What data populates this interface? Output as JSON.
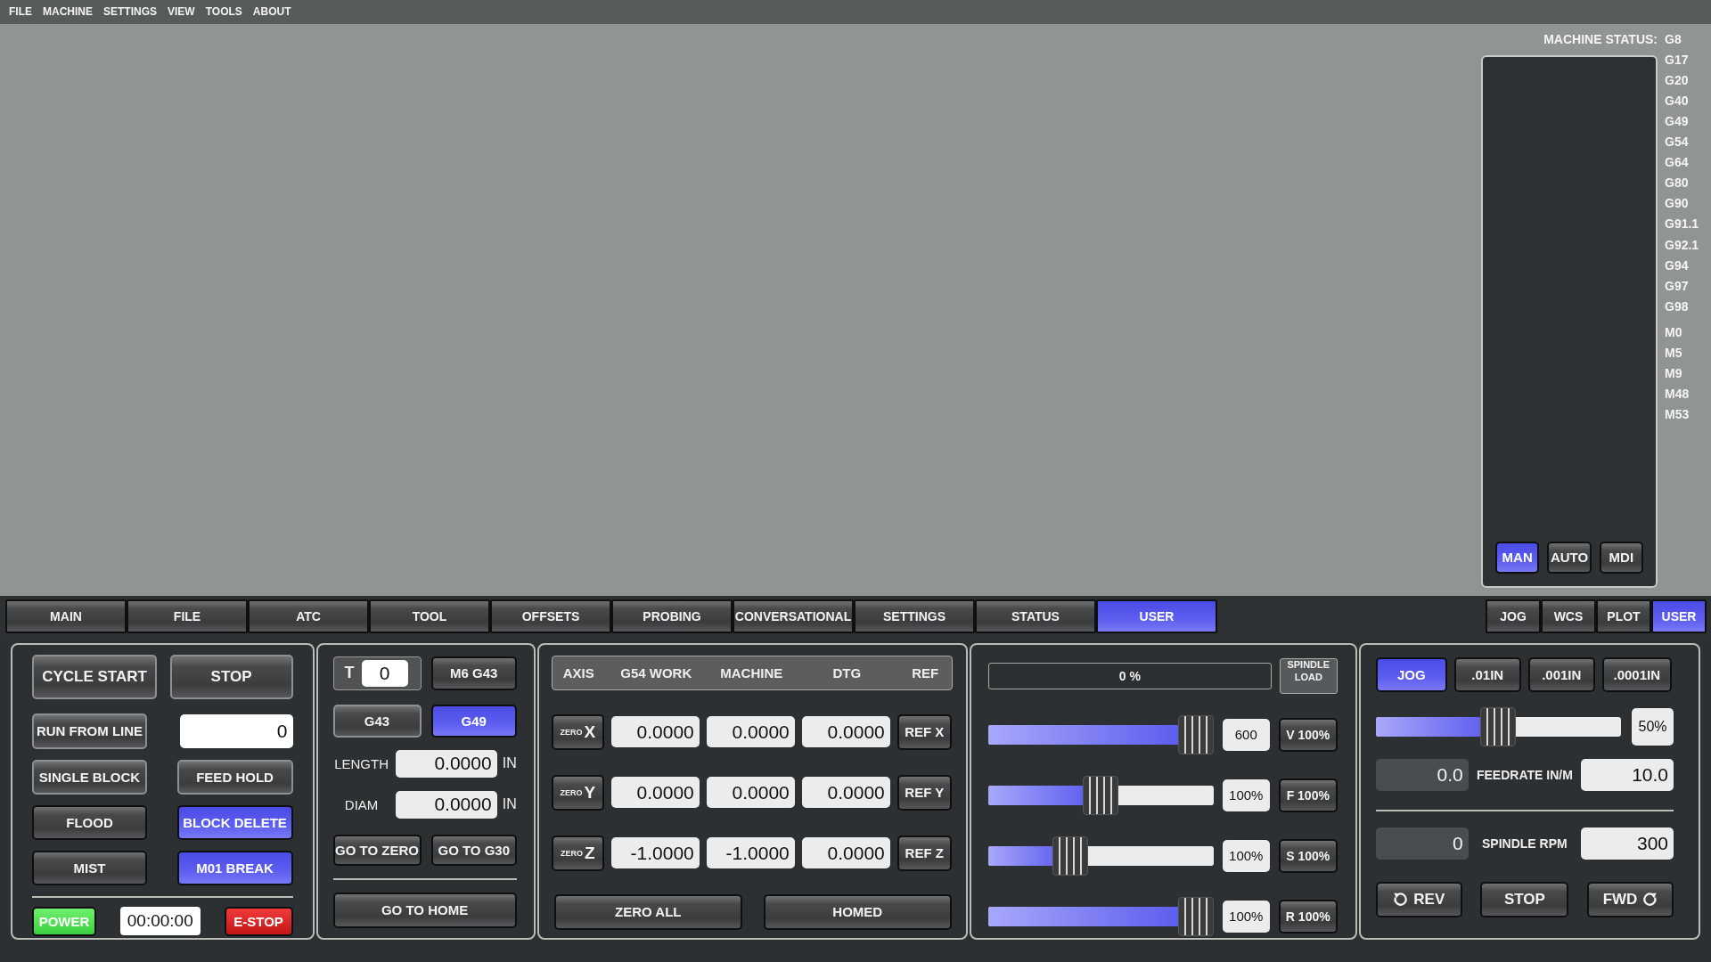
{
  "menu": [
    "FILE",
    "MACHINE",
    "SETTINGS",
    "VIEW",
    "TOOLS",
    "ABOUT"
  ],
  "machine_status": {
    "label": "MACHINE STATUS:",
    "g_codes": [
      "G8",
      "G17",
      "G20",
      "G40",
      "G49",
      "G54",
      "G64",
      "G80",
      "G90",
      "G91.1",
      "G92.1",
      "G94",
      "G97",
      "G98"
    ],
    "m_codes": [
      "M0",
      "M5",
      "M9",
      "M48",
      "M53"
    ],
    "modes": [
      {
        "label": "MAN",
        "selected": true
      },
      {
        "label": "AUTO",
        "selected": false
      },
      {
        "label": "MDI",
        "selected": false
      }
    ]
  },
  "tabs": [
    {
      "label": "MAIN",
      "selected": false
    },
    {
      "label": "FILE",
      "selected": false
    },
    {
      "label": "ATC",
      "selected": false
    },
    {
      "label": "TOOL",
      "selected": false
    },
    {
      "label": "OFFSETS",
      "selected": false
    },
    {
      "label": "PROBING",
      "selected": false
    },
    {
      "label": "CONVERSATIONAL",
      "selected": false
    },
    {
      "label": "SETTINGS",
      "selected": false
    },
    {
      "label": "STATUS",
      "selected": false
    },
    {
      "label": "USER",
      "selected": true
    }
  ],
  "side_tabs": [
    {
      "label": "JOG",
      "selected": false
    },
    {
      "label": "WCS",
      "selected": false
    },
    {
      "label": "PLOT",
      "selected": false
    },
    {
      "label": "USER",
      "selected": true
    }
  ],
  "program_panel": {
    "cycle_start": "CYCLE START",
    "stop": "STOP",
    "run_from_line": {
      "label": "RUN FROM LINE",
      "value": "0"
    },
    "toggles": [
      {
        "label": "SINGLE BLOCK",
        "on": false
      },
      {
        "label": "FEED HOLD",
        "on": false
      },
      {
        "label": "FLOOD",
        "on": false
      },
      {
        "label": "BLOCK DELETE",
        "on": true
      },
      {
        "label": "MIST",
        "on": false
      },
      {
        "label": "M01 BREAK",
        "on": true
      }
    ],
    "power": {
      "label": "POWER",
      "on": true
    },
    "timer": "00:00:00",
    "estop": "E-STOP"
  },
  "tool_panel": {
    "tool_label": "T",
    "tool_number": "0",
    "m6_button": "M6 G43",
    "offsets": [
      {
        "label": "G43",
        "selected": false
      },
      {
        "label": "G49",
        "selected": true
      }
    ],
    "length": {
      "label": "LENGTH",
      "value": "0.0000",
      "unit": "IN"
    },
    "diam": {
      "label": "DIAM",
      "value": "0.0000",
      "unit": "IN"
    },
    "go_to_zero": "GO TO ZERO",
    "go_to_g30": "GO TO G30",
    "go_to_home": "GO TO HOME"
  },
  "dro_panel": {
    "columns": [
      "AXIS",
      "G54 WORK",
      "MACHINE",
      "DTG",
      "REF"
    ],
    "rows": [
      {
        "zero": "ZERO",
        "axis": "X",
        "work": "0.0000",
        "machine": "0.0000",
        "dtg": "0.0000",
        "ref": "REF X"
      },
      {
        "zero": "ZERO",
        "axis": "Y",
        "work": "0.0000",
        "machine": "0.0000",
        "dtg": "0.0000",
        "ref": "REF Y"
      },
      {
        "zero": "ZERO",
        "axis": "Z",
        "work": "-1.0000",
        "machine": "-1.0000",
        "dtg": "0.0000",
        "ref": "REF Z"
      }
    ],
    "zero_all": "ZERO ALL",
    "homed": "HOMED"
  },
  "override_panel": {
    "spindle_load": {
      "reading": "0 %",
      "label": "SPINDLE LOAD"
    },
    "sliders": [
      {
        "level": 1,
        "reading": "600",
        "button": "V 100%"
      },
      {
        "level": 0.5,
        "reading": "100%",
        "button": "F 100%"
      },
      {
        "level": 0.34,
        "reading": "100%",
        "button": "S 100%"
      },
      {
        "level": 1,
        "reading": "100%",
        "button": "R 100%"
      }
    ]
  },
  "jog_panel": {
    "increments": [
      {
        "label": "JOG",
        "selected": true
      },
      {
        "label": ".01IN",
        "selected": false
      },
      {
        "label": ".001IN",
        "selected": false
      },
      {
        "label": ".0001IN",
        "selected": false
      }
    ],
    "jog_rate": {
      "level": 0.5,
      "reading": "50%"
    },
    "feedrate": {
      "actual": "0.0",
      "label": "FEEDRATE IN/M",
      "set": "10.0"
    },
    "spindle": {
      "actual": "0",
      "label": "SPINDLE RPM",
      "set": "300"
    },
    "spindle_buttons": [
      {
        "label": "REV",
        "kind": "rev"
      },
      {
        "label": "STOP",
        "kind": "stop"
      },
      {
        "label": "FWD",
        "kind": "fwd"
      }
    ]
  }
}
